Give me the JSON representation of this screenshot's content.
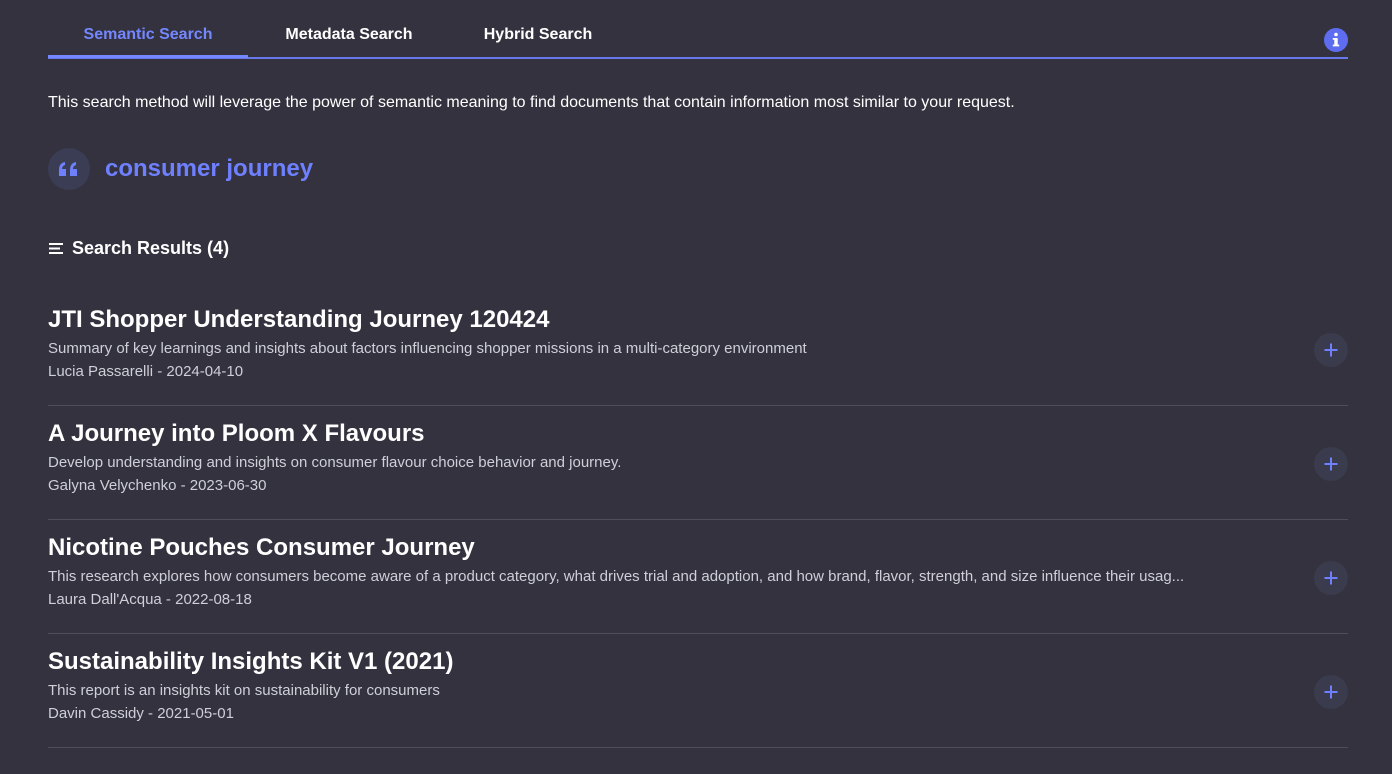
{
  "tabs": [
    {
      "label": "Semantic Search",
      "active": true
    },
    {
      "label": "Metadata Search",
      "active": false
    },
    {
      "label": "Hybrid Search",
      "active": false
    }
  ],
  "info_icon": "info-icon",
  "description": "This search method will leverage the power of semantic meaning to find documents that contain information most similar to your request.",
  "query": {
    "icon": "quote-icon",
    "text": "consumer journey"
  },
  "results_header": {
    "icon": "list-icon",
    "label": "Search Results (4)"
  },
  "results": [
    {
      "title": "JTI Shopper Understanding Journey 120424",
      "summary": "Summary of key learnings and insights about factors influencing shopper missions in a multi-category environment",
      "meta": "Lucia Passarelli - 2024-04-10"
    },
    {
      "title": "A Journey into Ploom X Flavours",
      "summary": "Develop understanding and insights on consumer flavour choice behavior and journey.",
      "meta": "Galyna Velychenko - 2023-06-30"
    },
    {
      "title": "Nicotine Pouches Consumer Journey",
      "summary": "This research explores how consumers become aware of a product category, what drives trial and adoption, and how brand, flavor, strength, and size influence their usag...",
      "meta": "Laura Dall'Acqua - 2022-08-18"
    },
    {
      "title": "Sustainability Insights Kit V1 (2021)",
      "summary": "This report is an insights kit on sustainability for consumers",
      "meta": "Davin Cassidy - 2021-05-01"
    }
  ],
  "colors": {
    "background": "#33323e",
    "accent": "#7587ff",
    "text": "#ffffff",
    "muted_text": "#cfcfd8",
    "divider": "#4e4d5c"
  }
}
